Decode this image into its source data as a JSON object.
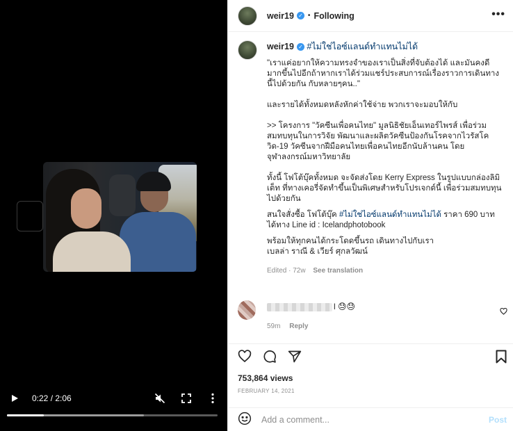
{
  "video": {
    "current_time": "0:22",
    "duration": "2:06",
    "time_separator": " / ",
    "progress_fraction": 0.175,
    "icons": [
      "play-icon",
      "mute-icon",
      "fullscreen-icon",
      "more-vertical-icon"
    ]
  },
  "header": {
    "username": "weir19",
    "separator": "•",
    "follow_status": "Following",
    "more_icon": "more-horizontal-icon"
  },
  "caption": {
    "username": "weir19",
    "hashtag": "#ไม่ใช่ไอซ์แลนด์ทำแทนไม่ได้",
    "text": "\"เราแค่อยากให้ความทรงจำของเราเป็นสิ่งที่จับต้องได้ และมันคงดีมากขึ้นไปอีกถ้าหากเราได้ร่วมแชร์ประสบการณ์เรื่องราวการเดินทางนี้ไปด้วยกัน กับหลายๆคน..\"\n\nและรายได้ทั้งหมดหลังหักค่าใช้จ่าย พวกเราจะมอบให้กับ\n\n>> โครงการ \"วัคซีนเพื่อคนไทย\" มูลนิธิชัยเอ็นเทอร์ไพรส์ เพื่อร่วมสมทบทุนในการวิจัย พัฒนาและผลิตวัคซีนป้องกันโรคจากไวรัสโควิด-19 วัคซีนจากฝีมือคนไทยเพื่อคนไทยอีกนับล้านคน โดยจุฬาลงกรณ์มหาวิทยาลัย\n\nทั้งนี้ โฟโต้บุ๊คทั้งหมด จะจัดส่งโดย Kerry Express ในรูปแบบกล่องลิมิเต็ท ที่ทางเคอรี่จัดทำขึ้นเป็นพิเศษสำหรับโปรเจกต์นี้ เพื่อร่วมสมทบทุนไปด้วยกัน",
    "order_prefix": "สนใจสั่งซื้อ โฟโต้บุ๊ค ",
    "order_hashtag": "#ไม่ใช่ไอซ์แลนด์ทำแทนไม่ได้",
    "order_suffix": " ราคา 690 บาท\nได้ทาง Line id : Icelandphotobook",
    "closing": "พร้อมให้ทุกคนได้กระโดดขึ้นรถ เดินทางไปกับเรา\nเบลล่า ราณี & เวียร์ ศุกลวัฒน์",
    "edited": "Edited · 72w",
    "see_translation": "See translation"
  },
  "comment": {
    "suffix": "l 😓😓",
    "time": "59m",
    "reply_label": "Reply"
  },
  "stats": {
    "views": "753,864 views",
    "date": "FEBRUARY 14, 2021"
  },
  "composer": {
    "placeholder": "Add a comment...",
    "post_label": "Post"
  },
  "colors": {
    "link": "#00376b",
    "verified": "#3897f0",
    "post_disabled": "#b2dffc",
    "muted": "#8e8e8e"
  }
}
